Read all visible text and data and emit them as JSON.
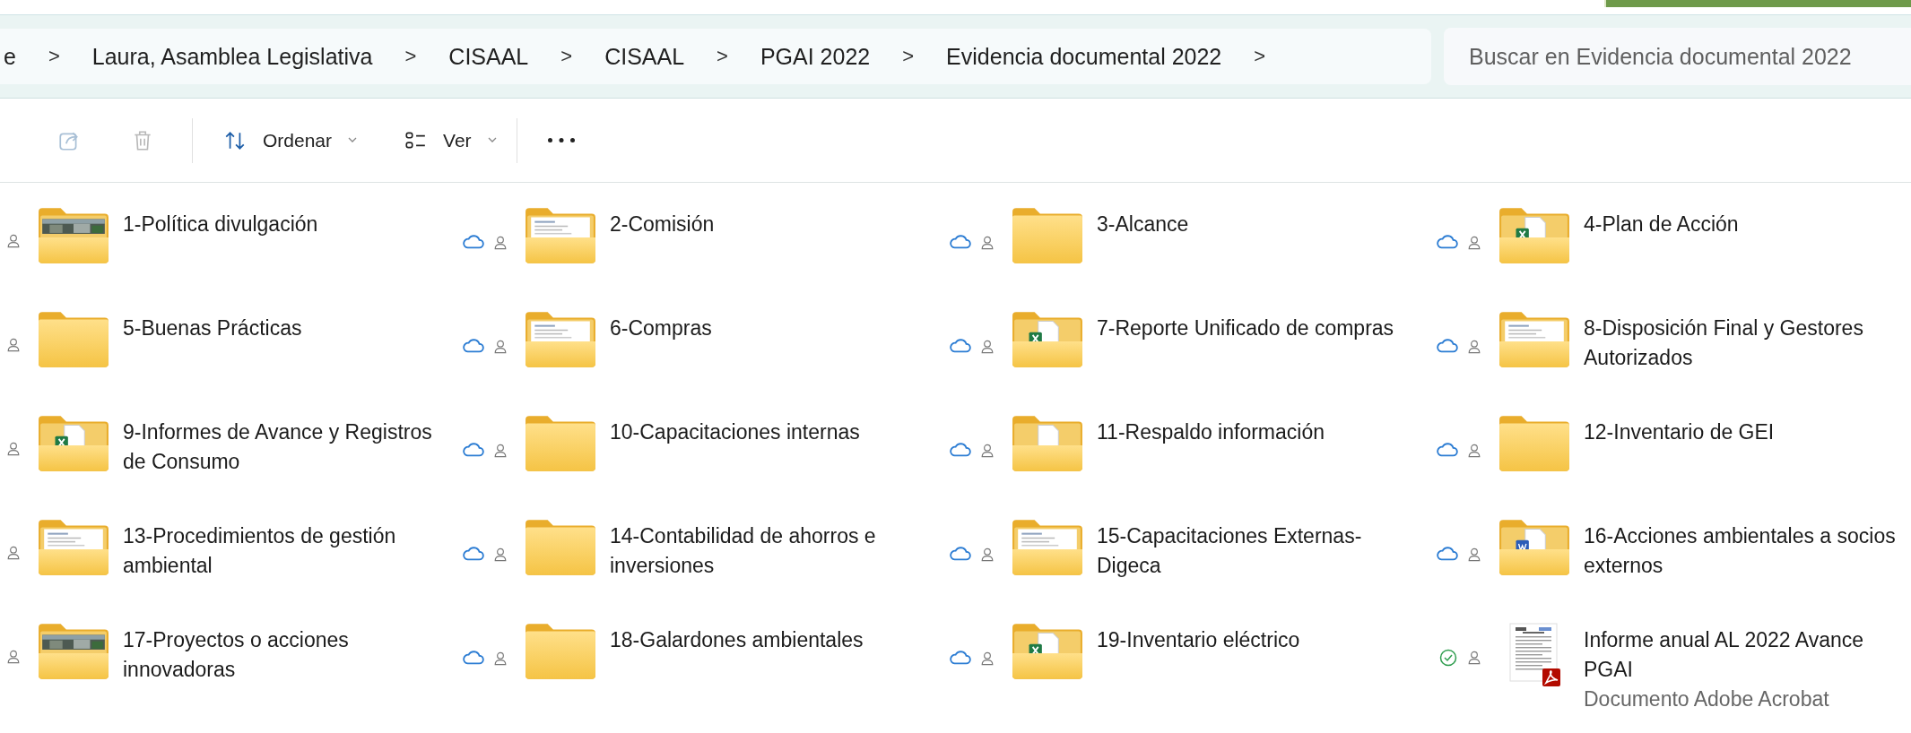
{
  "breadcrumb": {
    "separator": ">",
    "items": [
      {
        "label": "e"
      },
      {
        "label": "Laura, Asamblea Legislativa"
      },
      {
        "label": "CISAAL"
      },
      {
        "label": "CISAAL"
      },
      {
        "label": "PGAI 2022"
      },
      {
        "label": "Evidencia documental 2022"
      }
    ]
  },
  "search": {
    "placeholder": "Buscar en Evidencia documental 2022"
  },
  "toolbar": [
    {
      "kind": "share",
      "disabled": true
    },
    {
      "kind": "delete",
      "disabled": true
    },
    {
      "kind": "sort",
      "label": "Ordenar",
      "disabled": false,
      "dropdown": true
    },
    {
      "kind": "view",
      "label": "Ver",
      "disabled": false,
      "dropdown": true
    },
    {
      "kind": "more",
      "disabled": false
    }
  ],
  "items": [
    {
      "name": "1-Política divulgación",
      "kind": "photofolder",
      "shared": true
    },
    {
      "name": "2-Comisión",
      "kind": "docfolder",
      "downloaded": false,
      "shared": true
    },
    {
      "name": "3-Alcance",
      "kind": "folder",
      "downloaded": false,
      "shared": true
    },
    {
      "name": "4-Plan de Acción",
      "kind": "excelfolder",
      "downloaded": false,
      "shared": true
    },
    {
      "name": "5-Buenas Prácticas",
      "kind": "folder",
      "shared": true
    },
    {
      "name": "6-Compras",
      "kind": "docfolder",
      "downloaded": false,
      "shared": true
    },
    {
      "name": "7-Reporte Unificado de compras",
      "kind": "excelfolder",
      "downloaded": false,
      "shared": true
    },
    {
      "name": "8-Disposición Final y Gestores Autorizados",
      "kind": "docfolder",
      "downloaded": false,
      "shared": true
    },
    {
      "name": "9-Informes de Avance y Registros de Consumo",
      "kind": "excelfolder",
      "shared": true
    },
    {
      "name": "10-Capacitaciones internas",
      "kind": "folder",
      "downloaded": false,
      "shared": true
    },
    {
      "name": "11-Respaldo información",
      "kind": "pagefolder",
      "downloaded": false,
      "shared": true
    },
    {
      "name": "12-Inventario de GEI",
      "kind": "folder",
      "downloaded": false,
      "shared": true
    },
    {
      "name": "13-Procedimientos de gestión ambiental",
      "kind": "docfolder",
      "shared": true
    },
    {
      "name": "14-Contabilidad de ahorros e inversiones",
      "kind": "folder",
      "downloaded": false,
      "shared": true
    },
    {
      "name": "15-Capacitaciones Externas-Digeca",
      "kind": "docfolder",
      "downloaded": false,
      "shared": true
    },
    {
      "name": "16-Acciones ambientales a socios externos",
      "kind": "wordfolder",
      "downloaded": false,
      "shared": true
    },
    {
      "name": "17-Proyectos o acciones innovadoras",
      "kind": "photofolder",
      "shared": true
    },
    {
      "name": "18-Galardones ambientales",
      "kind": "folder",
      "downloaded": false,
      "shared": true
    },
    {
      "name": "19-Inventario eléctrico",
      "kind": "excelfolder",
      "downloaded": false,
      "shared": true
    },
    {
      "name": "Informe anual AL 2022 Avance PGAI",
      "kind": "pdf",
      "type": "Documento Adobe Acrobat",
      "downloaded": true,
      "shared": true
    }
  ]
}
